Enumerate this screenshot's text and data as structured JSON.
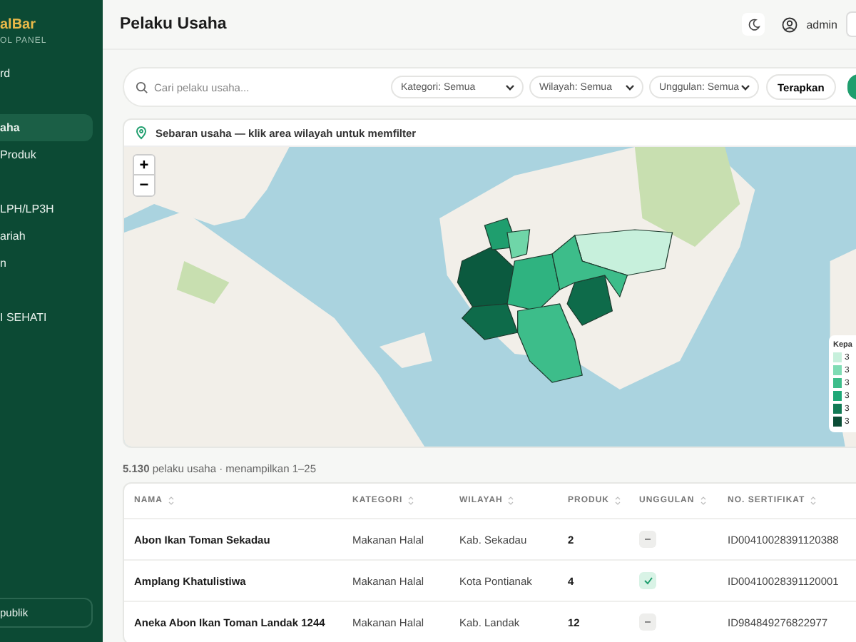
{
  "sidebar": {
    "brand": "alBar",
    "subtitle": "OL PANEL",
    "groups": [
      {
        "items": [
          {
            "label": "rd",
            "selected": false
          }
        ]
      },
      {
        "items": [
          {
            "label": "aha",
            "selected": true
          },
          {
            "label": "Produk",
            "selected": false
          }
        ]
      },
      {
        "items": [
          {
            "label": "LPH/LP3H",
            "selected": false
          },
          {
            "label": "ariah",
            "selected": false
          },
          {
            "label": "n",
            "selected": false
          }
        ]
      },
      {
        "items": [
          {
            "label": "I SEHATI",
            "selected": false
          }
        ]
      }
    ],
    "footer_button": "publik"
  },
  "header": {
    "title": "Pelaku Usaha",
    "user": "admin"
  },
  "filters": {
    "search": {
      "placeholder": "Cari pelaku usaha..."
    },
    "selects": [
      "Kategori: Semua",
      "Wilayah: Semua",
      "Unggulan: Semua"
    ],
    "apply": "Terapkan"
  },
  "map": {
    "title": "Sebaran usaha — klik area wilayah untuk memfilter",
    "zoom_in": "+",
    "zoom_out": "−",
    "legend": {
      "title": "Kepa",
      "items": [
        {
          "label": "3",
          "color": "#c7f0dc"
        },
        {
          "label": "3",
          "color": "#7fdcb4"
        },
        {
          "label": "3",
          "color": "#3dbd8a"
        },
        {
          "label": "3",
          "color": "#1fa877"
        },
        {
          "label": "3",
          "color": "#127a55"
        },
        {
          "label": "3",
          "color": "#0b4d36"
        }
      ]
    }
  },
  "summary": "**5.130** pelaku usaha · menampilkan 1–25",
  "table": {
    "columns": [
      "NAMA",
      "KATEGORI",
      "WILAYAH",
      "PRODUK",
      "UNGGULAN",
      "NO. SERTIFIKAT"
    ],
    "rows": [
      {
        "nama": "Abon Ikan Toman Sekadau",
        "kategori": "Makanan Halal",
        "wilayah": "Kab. Sekadau",
        "produk": "2",
        "unggulan": false,
        "sertifikat": "ID00410028391120388"
      },
      {
        "nama": "Amplang Khatulistiwa",
        "kategori": "Makanan Halal",
        "wilayah": "Kota Pontianak",
        "produk": "4",
        "unggulan": true,
        "sertifikat": "ID00410028391120001"
      },
      {
        "nama": "Aneka Abon Ikan Toman Landak 1244",
        "kategori": "Makanan Halal",
        "wilayah": "Kab. Landak",
        "produk": "12",
        "unggulan": false,
        "sertifikat": "ID984849276822977"
      }
    ]
  }
}
